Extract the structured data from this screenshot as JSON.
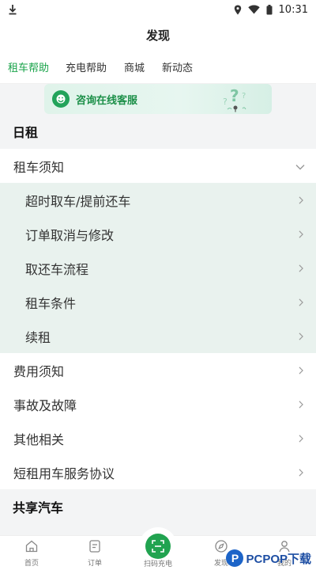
{
  "statusbar": {
    "time": "10:31"
  },
  "appbar": {
    "title": "发现"
  },
  "tabs": [
    {
      "label": "租车帮助",
      "active": true
    },
    {
      "label": "充电帮助",
      "active": false
    },
    {
      "label": "商城",
      "active": false
    },
    {
      "label": "新动态",
      "active": false
    }
  ],
  "banner": {
    "text": "咨询在线客服"
  },
  "sections": {
    "daily": {
      "title": "日租",
      "rental_notice": "租车须知",
      "sub_items": [
        "超时取车/提前还车",
        "订单取消与修改",
        "取还车流程",
        "租车条件",
        "续租"
      ],
      "items": [
        "费用须知",
        "事故及故障",
        "其他相关",
        "短租用车服务协议"
      ]
    },
    "shared": {
      "title": "共享汽车"
    }
  },
  "tabbar": {
    "home": "首页",
    "orders": "订单",
    "scan": "扫码充电",
    "discover": "发现",
    "mine": "我的"
  },
  "watermark": {
    "text": "PCPOP下载",
    "letter": "P"
  },
  "colors": {
    "accent": "#19a34a",
    "sub_bg": "#e9f2ee",
    "section_bg": "#f3f4f5"
  }
}
